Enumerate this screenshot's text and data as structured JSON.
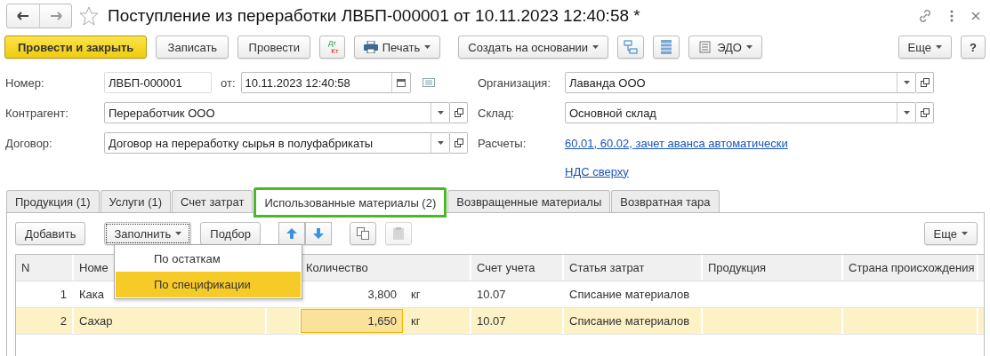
{
  "window": {
    "title": "Поступление из переработки ЛВБП-000001 от 10.11.2023 12:40:58 *",
    "favorite": false
  },
  "toolbar": {
    "post_and_close": "Провести и закрыть",
    "save": "Записать",
    "post": "Провести",
    "dtkt": {
      "debit": "Дт",
      "credit": "Кт"
    },
    "print": "Печать",
    "create_based_on": "Создать на основании",
    "edo": "ЭДО",
    "more": "Еще",
    "help": "?"
  },
  "form": {
    "number": {
      "label": "Номер:",
      "value": "ЛВБП-000001"
    },
    "date": {
      "label": "от:",
      "value": "10.11.2023 12:40:58"
    },
    "counterparty": {
      "label": "Контрагент:",
      "value": "Переработчик ООО"
    },
    "contract": {
      "label": "Договор:",
      "value": "Договор на переработку сырья в полуфабрикаты"
    },
    "organization": {
      "label": "Организация:",
      "value": "Лаванда ООО"
    },
    "warehouse": {
      "label": "Склад:",
      "value": "Основной склад"
    },
    "settlements": {
      "label": "Расчеты:",
      "link": "60.01, 60.02, зачет аванса автоматически"
    },
    "vat_link": "НДС сверху"
  },
  "tabs": [
    {
      "label": "Продукция (1)",
      "selected": false
    },
    {
      "label": "Услуги (1)",
      "selected": false
    },
    {
      "label": "Счет затрат",
      "selected": false
    },
    {
      "label": "Использованные материалы (2)",
      "selected": true
    },
    {
      "label": "Возвращенные материалы",
      "selected": false
    },
    {
      "label": "Возвратная тара",
      "selected": false
    }
  ],
  "table_toolbar": {
    "add": "Добавить",
    "fill": "Заполнить",
    "pick": "Подбор",
    "more": "Еще"
  },
  "fill_menu": {
    "expanded": true,
    "items": [
      {
        "label": "По остаткам",
        "selected": false
      },
      {
        "label": "По спецификации",
        "selected": true
      }
    ]
  },
  "table": {
    "columns": [
      "N",
      "Номе",
      "",
      "Количество",
      "Счет учета",
      "Статья затрат",
      "Продукция",
      "Страна происхождения"
    ],
    "rows": [
      {
        "n": "1",
        "name": "Кака",
        "quantity": "3,800",
        "unit": "кг",
        "account": "10.07",
        "cost_item": "Списание материалов",
        "selected": false,
        "quantity_focused": false
      },
      {
        "n": "2",
        "name": "Сахар",
        "quantity": "1,650",
        "unit": "кг",
        "account": "10.07",
        "cost_item": "Списание материалов",
        "selected": true,
        "quantity_focused": true
      }
    ]
  }
}
